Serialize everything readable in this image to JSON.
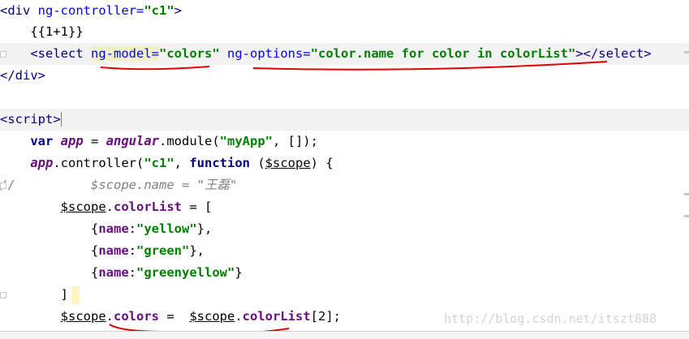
{
  "code": {
    "l1": {
      "lt": "<",
      "tag": "div",
      "attr": " ng-controller=",
      "val": "\"c1\"",
      "gt": ">"
    },
    "l2": {
      "text": "{{1+1}}"
    },
    "l3": {
      "lt": "<",
      "tag": "select",
      "sp": " ",
      "attr1": "ng-model=",
      "val1": "\"colors\"",
      "sp2": " ",
      "attr2": "ng-options=",
      "val2": "\"color.name for color in colorList\"",
      "close": "></select>"
    },
    "l4": {
      "text": "</div>"
    },
    "l6": {
      "lt": "<",
      "tag": "script",
      "gt": ">"
    },
    "l7": {
      "kw": "var ",
      "name": "app",
      "eq": " = ",
      "obj": "angular",
      "dot": ".",
      "fn": "module(",
      "arg1": "\"myApp\"",
      "rest": ", []);"
    },
    "l8": {
      "obj": "app",
      "dot": ".",
      "fn": "controller(",
      "arg1": "\"c1\"",
      "comma": ", ",
      "kw": "function",
      "sp": " (",
      "param": "$scope",
      "rest": ") {"
    },
    "l9": {
      "slashes": "//",
      "body": "$scope.name = \"王磊\""
    },
    "l10": {
      "scope": "$scope",
      "dot": ".",
      "fld": "colorList",
      "rest": " = ["
    },
    "l11": {
      "open": "{",
      "key": "name",
      "colon": ":",
      "val": "\"yellow\"",
      "close": "},"
    },
    "l12": {
      "open": "{",
      "key": "name",
      "colon": ":",
      "val": "\"green\"",
      "close": "},"
    },
    "l13": {
      "open": "{",
      "key": "name",
      "colon": ":",
      "val": "\"greenyellow\"",
      "close": "}"
    },
    "l14": {
      "text": "]"
    },
    "l15": {
      "scope": "$scope",
      "dot": ".",
      "fld": "colors",
      "eq": " =  ",
      "scope2": "$scope",
      "dot2": ".",
      "fld2": "colorList",
      "idx": "[2];"
    }
  },
  "watermark": "http://blog.csdn.net/itszt888",
  "colors": {
    "tag": "#000080",
    "attr": "#0000ff",
    "string": "#008000",
    "annotation": "#e00000"
  }
}
